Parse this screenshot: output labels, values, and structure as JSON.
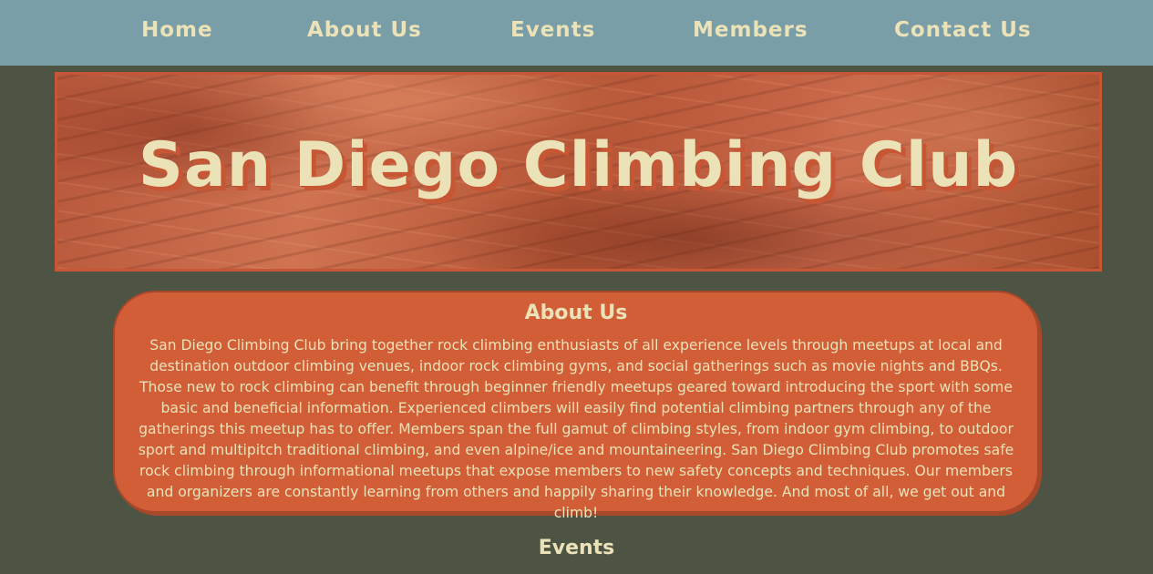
{
  "nav": {
    "items": [
      {
        "label": "Home"
      },
      {
        "label": "About Us"
      },
      {
        "label": "Events"
      },
      {
        "label": "Members"
      },
      {
        "label": "Contact Us"
      }
    ]
  },
  "banner": {
    "title": "San Diego Climbing Club"
  },
  "about": {
    "heading": "About Us",
    "body": "San Diego Climbing Club bring together rock climbing enthusiasts of all experience levels through meetups at local and destination outdoor climbing venues, indoor rock climbing gyms, and social gatherings such as movie nights and BBQs. Those new to rock climbing can benefit through beginner friendly meetups geared toward introducing the sport with some basic and beneficial information. Experienced climbers will easily find potential climbing partners through any of the gatherings this meetup has to offer. Members span the full gamut of climbing styles, from indoor gym climbing, to outdoor sport and multipitch traditional climbing, and even alpine/ice and mountaineering. San Diego Climbing Club promotes safe rock climbing through informational meetups that expose members to new safety concepts and techniques. Our members and organizers are constantly learning from others and happily sharing their knowledge. And most of all, we get out and climb!"
  },
  "events": {
    "heading": "Events"
  },
  "colors": {
    "nav_background": "#7a9ea8",
    "page_background": "#4d5443",
    "accent": "#d15e37",
    "text": "#ebe2b8"
  }
}
